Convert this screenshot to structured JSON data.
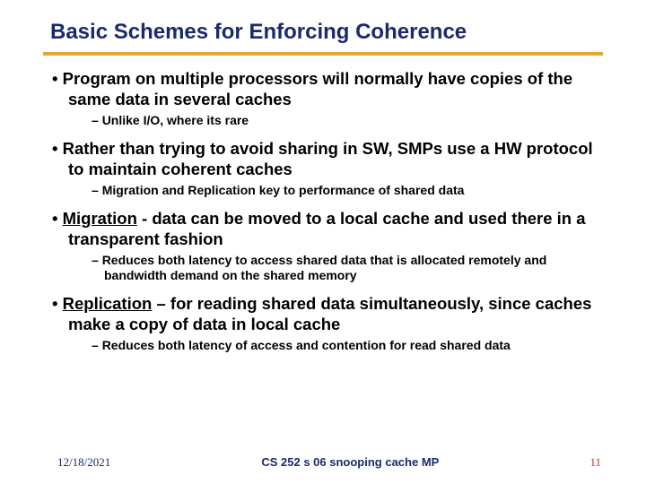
{
  "title": "Basic Schemes for Enforcing Coherence",
  "bullets": [
    {
      "level": 1,
      "html": "Program on multiple processors will normally have copies of the same data in several caches"
    },
    {
      "level": 2,
      "html": "Unlike I/O, where its rare"
    },
    {
      "level": 1,
      "html": "Rather than trying to avoid sharing in SW, SMPs use a HW protocol to maintain coherent caches"
    },
    {
      "level": 2,
      "html": "Migration and Replication key to performance of shared data"
    },
    {
      "level": 1,
      "html": "<span class='u'>Migration</span> - data can be moved to a local cache and used there in a transparent fashion"
    },
    {
      "level": 2,
      "html": "Reduces both latency to access shared data that is allocated remotely and bandwidth demand on the shared memory"
    },
    {
      "level": 1,
      "html": "<span class='u'>Replication</span> – for reading shared data simultaneously, since caches make a copy of data in local cache"
    },
    {
      "level": 2,
      "html": "Reduces both latency of access and contention for read shared data"
    }
  ],
  "footer": {
    "date": "12/18/2021",
    "course": "CS 252 s 06 snooping cache MP",
    "page": "11"
  }
}
